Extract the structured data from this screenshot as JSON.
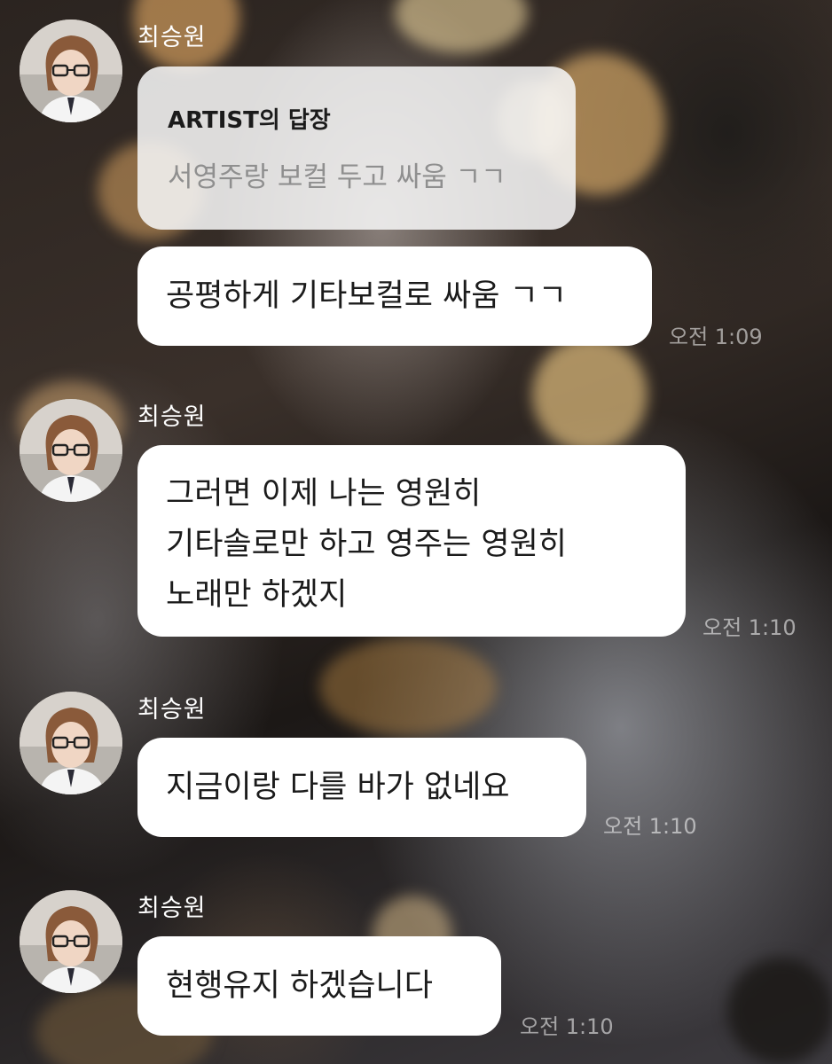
{
  "chat": {
    "messages": [
      {
        "sender": "최승원",
        "reply_title": "ARTIST의 답장",
        "reply_text": "서영주랑 보컬 두고 싸움 ㄱㄱ",
        "text": "공평하게 기타보컬로 싸움 ㄱㄱ",
        "time": "오전 1:09"
      },
      {
        "sender": "최승원",
        "lines": [
          "그러면 이제 나는 영원히",
          "기타솔로만 하고 영주는 영원히",
          "노래만 하겠지"
        ],
        "time": "오전 1:10"
      },
      {
        "sender": "최승원",
        "text": "지금이랑 다를 바가 없네요",
        "time": "오전 1:10"
      },
      {
        "sender": "최승원",
        "text": "현행유지 하겠습니다",
        "time": "오전 1:10"
      }
    ]
  },
  "colors": {
    "bubble": "#ffffff",
    "reply_bubble": "#f5f5f5",
    "reply_text": "#8f8f8f",
    "time_text": "#ffffff8c"
  },
  "icons": {
    "avatar": "profile-photo"
  }
}
